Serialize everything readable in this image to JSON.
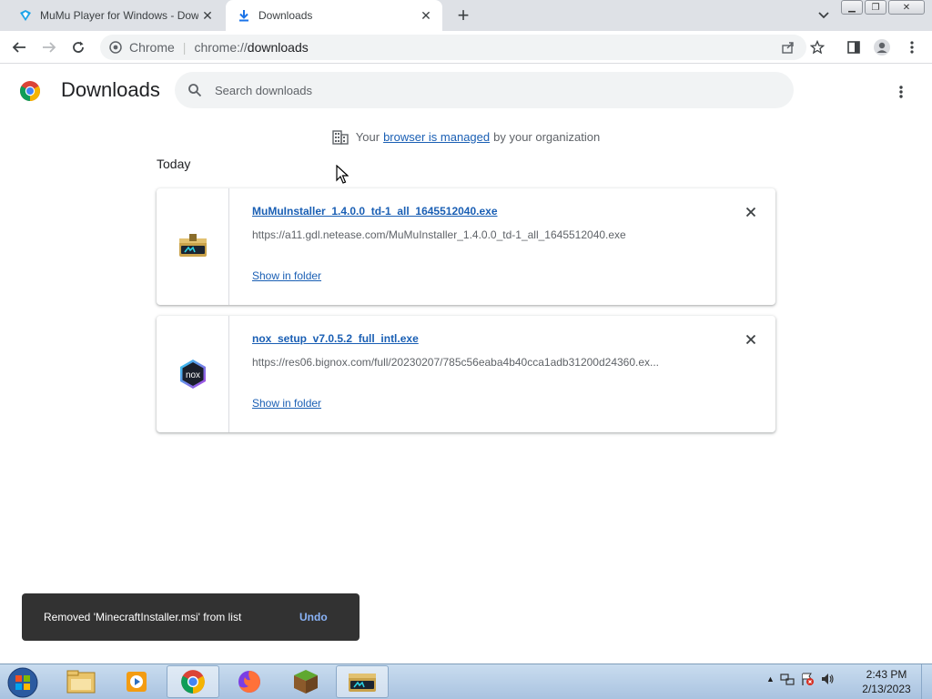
{
  "browser": {
    "tabs": [
      {
        "title": "MuMu Player for Windows - Dow",
        "active": false
      },
      {
        "title": "Downloads",
        "active": true
      }
    ],
    "new_tab_label": "+",
    "omnibox": {
      "chip": "Chrome",
      "url_scheme": "chrome://",
      "url_host": "downloads"
    }
  },
  "page": {
    "title": "Downloads",
    "search_placeholder": "Search downloads",
    "managed": {
      "prefix": "Your",
      "link": "browser is managed",
      "suffix": "by your organization"
    },
    "date_header": "Today",
    "downloads": [
      {
        "filename": "MuMuInstaller_1.4.0.0_td-1_all_1645512040.exe",
        "url": "https://a11.gdl.netease.com/MuMuInstaller_1.4.0.0_td-1_all_1645512040.exe",
        "action": "Show in folder",
        "icon": "mumu-installer-icon"
      },
      {
        "filename": "nox_setup_v7.0.5.2_full_intl.exe",
        "url": "https://res06.bignox.com/full/20230207/785c56eaba4b40cca1adb31200d24360.ex...",
        "action": "Show in folder",
        "icon": "nox-icon"
      }
    ]
  },
  "toast": {
    "message": "Removed 'MinecraftInstaller.msi' from list",
    "action": "Undo"
  },
  "taskbar": {
    "items": [
      "start-orb",
      "file-explorer",
      "media-player",
      "chrome",
      "firefox",
      "minecraft",
      "mumu"
    ],
    "clock_time": "2:43 PM",
    "clock_date": "2/13/2023"
  },
  "colors": {
    "link": "#1a5fb4",
    "toast_bg": "#323232",
    "toast_action": "#8ab4f8",
    "tabstrip_bg": "#dee1e6"
  }
}
